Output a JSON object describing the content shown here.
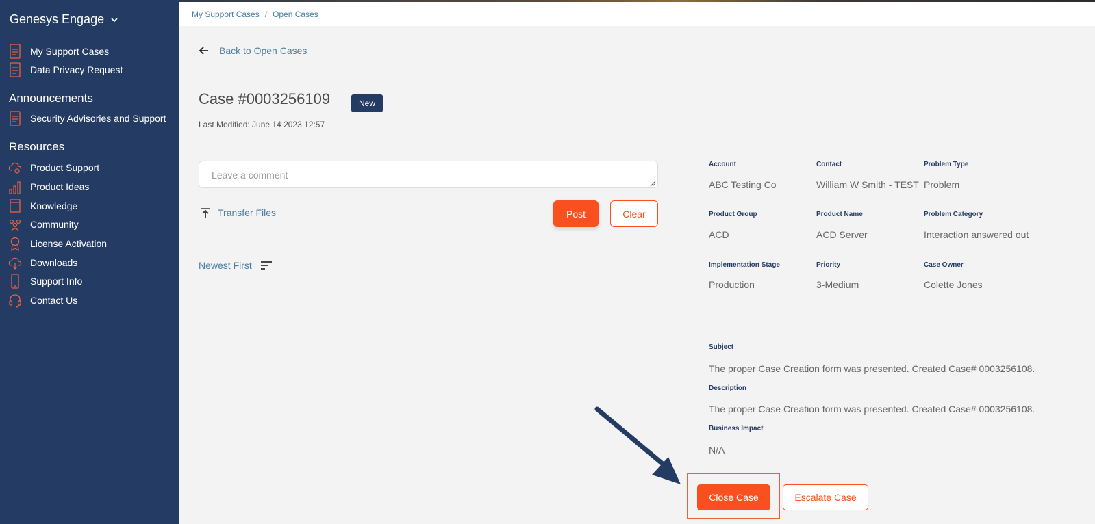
{
  "sidebar": {
    "brand": "Genesys Engage",
    "top_items": [
      {
        "label": "My Support Cases",
        "icon": "document-icon"
      },
      {
        "label": "Data Privacy Request",
        "icon": "document-icon"
      }
    ],
    "announcements_title": "Announcements",
    "announcements_items": [
      {
        "label": "Security Advisories and Support",
        "icon": "document-icon"
      }
    ],
    "resources_title": "Resources",
    "resources_items": [
      {
        "label": "Product Support",
        "icon": "cloud-gear-icon"
      },
      {
        "label": "Product Ideas",
        "icon": "chart-icon"
      },
      {
        "label": "Knowledge",
        "icon": "book-icon"
      },
      {
        "label": "Community",
        "icon": "people-icon"
      },
      {
        "label": "License Activation",
        "icon": "award-icon"
      },
      {
        "label": "Downloads",
        "icon": "cloud-download-icon"
      },
      {
        "label": "Support Info",
        "icon": "phone-icon"
      },
      {
        "label": "Contact Us",
        "icon": "headset-icon"
      }
    ]
  },
  "breadcrumb": {
    "first": "My Support Cases",
    "separator": "/",
    "second": "Open Cases"
  },
  "back_label": "Back to Open Cases",
  "case": {
    "title": "Case #0003256109",
    "status": "New",
    "last_modified": "Last Modified: June 14 2023 12:57"
  },
  "comment": {
    "placeholder": "Leave a comment"
  },
  "transfer_label": "Transfer Files",
  "post_label": "Post",
  "clear_label": "Clear",
  "sort_label": "Newest First",
  "details": {
    "account_label": "Account",
    "account_value": "ABC Testing Co",
    "contact_label": "Contact",
    "contact_value": "William W Smith - TEST",
    "problem_type_label": "Problem Type",
    "problem_type_value": "Problem",
    "product_group_label": "Product Group",
    "product_group_value": "ACD",
    "product_name_label": "Product Name",
    "product_name_value": "ACD Server",
    "problem_category_label": "Problem Category",
    "problem_category_value": "Interaction answered out",
    "impl_stage_label": "Implementation Stage",
    "impl_stage_value": "Production",
    "priority_label": "Priority",
    "priority_value": "3-Medium",
    "case_owner_label": "Case Owner",
    "case_owner_value": "Colette Jones",
    "subject_label": "Subject",
    "subject_value": "The proper Case Creation form was presented. Created Case# 0003256108.",
    "description_label": "Description",
    "description_value": "The proper Case Creation form was presented. Created Case# 0003256108.",
    "impact_label": "Business Impact",
    "impact_value": "N/A"
  },
  "close_label": "Close Case",
  "escalate_label": "Escalate Case",
  "colors": {
    "sidebar": "#243c64",
    "accent": "#fa4f1f",
    "link": "#4b7ea0"
  }
}
